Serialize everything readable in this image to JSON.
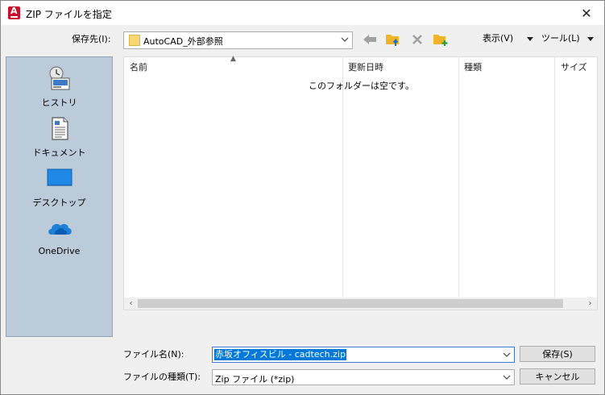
{
  "window": {
    "title": "ZIP ファイルを指定",
    "close_icon": "close-icon"
  },
  "toolbar": {
    "save_in_label": "保存先(I):",
    "folder": "AutoCAD_外部参照",
    "view_label": "表示(V)",
    "tools_label": "ツール(L)"
  },
  "places": [
    {
      "label": "ヒストリ",
      "icon": "history-icon"
    },
    {
      "label": "ドキュメント",
      "icon": "documents-icon"
    },
    {
      "label": "デスクトップ",
      "icon": "desktop-icon"
    },
    {
      "label": "OneDrive",
      "icon": "onedrive-icon"
    }
  ],
  "filelist": {
    "columns": [
      "名前",
      "更新日時",
      "種類",
      "サイズ"
    ],
    "empty_message": "このフォルダーは空です。"
  },
  "bottom": {
    "filename_label": "ファイル名(N):",
    "filename_value": "赤坂オフィスビル - cadtech.zip",
    "filetype_label": "ファイルの種類(T):",
    "filetype_value": "Zip ファイル (*zip)",
    "save_button": "保存(S)",
    "cancel_button": "キャンセル"
  },
  "colors": {
    "places_bg": "#bccbda",
    "selection": "#0078d7",
    "folder_yellow": "#f8d775",
    "accent_red": "#c8102e"
  }
}
